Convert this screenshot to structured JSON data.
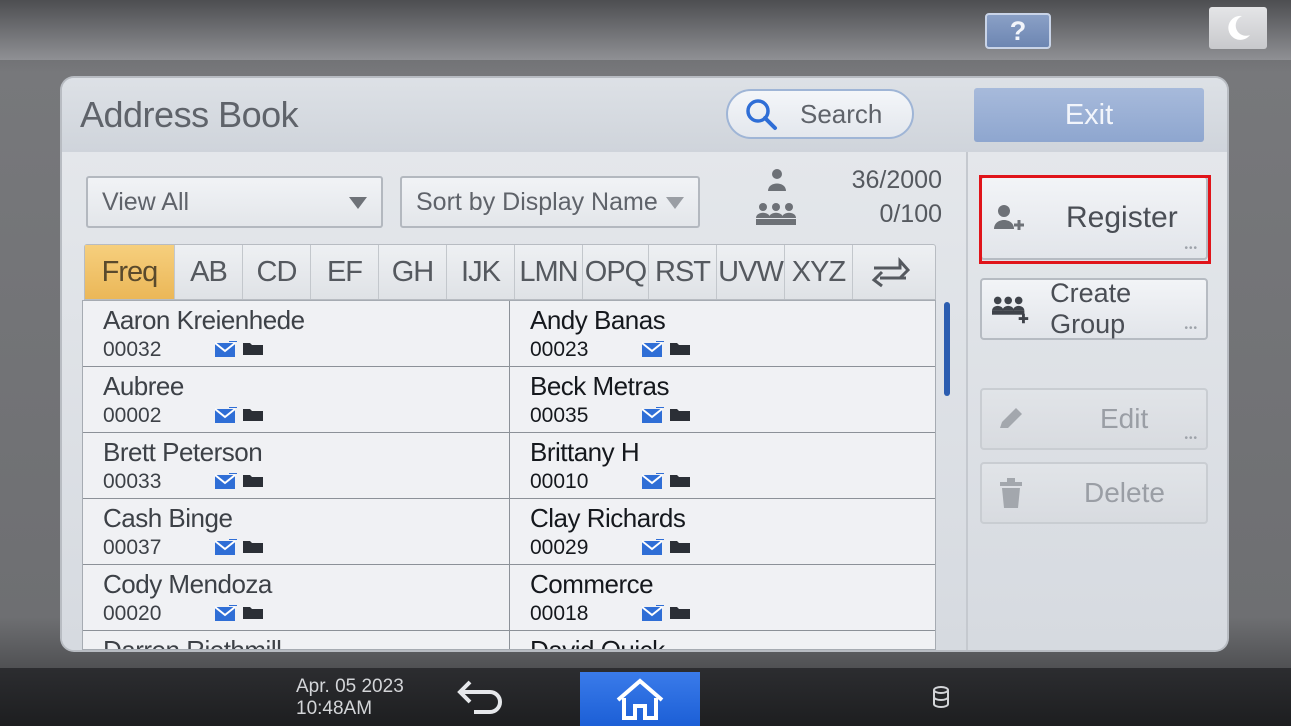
{
  "topbar": {
    "help_label": "?"
  },
  "dialog": {
    "title": "Address Book",
    "search_label": "Search",
    "exit_label": "Exit",
    "filter_select": "View All",
    "sort_select": "Sort by Display Name",
    "user_count": "36/2000",
    "group_count": "0/100"
  },
  "tabs": [
    "Freq",
    "AB",
    "CD",
    "EF",
    "GH",
    "IJK",
    "LMN",
    "OPQ",
    "RST",
    "UVW",
    "XYZ"
  ],
  "active_tab": "Freq",
  "contacts": [
    {
      "left": {
        "name": "Aaron Kreienhede",
        "number": "00032"
      },
      "right": {
        "name": "Andy Banas",
        "number": "00023"
      }
    },
    {
      "left": {
        "name": "Aubree",
        "number": "00002"
      },
      "right": {
        "name": "Beck Metras",
        "number": "00035"
      }
    },
    {
      "left": {
        "name": "Brett Peterson",
        "number": "00033"
      },
      "right": {
        "name": "Brittany H",
        "number": "00010"
      }
    },
    {
      "left": {
        "name": "Cash Binge",
        "number": "00037"
      },
      "right": {
        "name": "Clay Richards",
        "number": "00029"
      }
    },
    {
      "left": {
        "name": "Cody Mendoza",
        "number": "00020"
      },
      "right": {
        "name": "Commerce",
        "number": "00018"
      }
    },
    {
      "left": {
        "name": "Darren Riethmill",
        "number": ""
      },
      "right": {
        "name": "David Quick",
        "number": ""
      }
    }
  ],
  "side_buttons": {
    "register": "Register",
    "create_group": "Create Group",
    "edit": "Edit",
    "delete": "Delete"
  },
  "statusbar": {
    "date": "Apr. 05 2023",
    "time": "10:48AM"
  },
  "colors": {
    "accent_blue": "#1c5fd6",
    "active_tab": "#ebb758",
    "highlight": "#e0141a",
    "scroll_thumb": "#2c5db0"
  }
}
